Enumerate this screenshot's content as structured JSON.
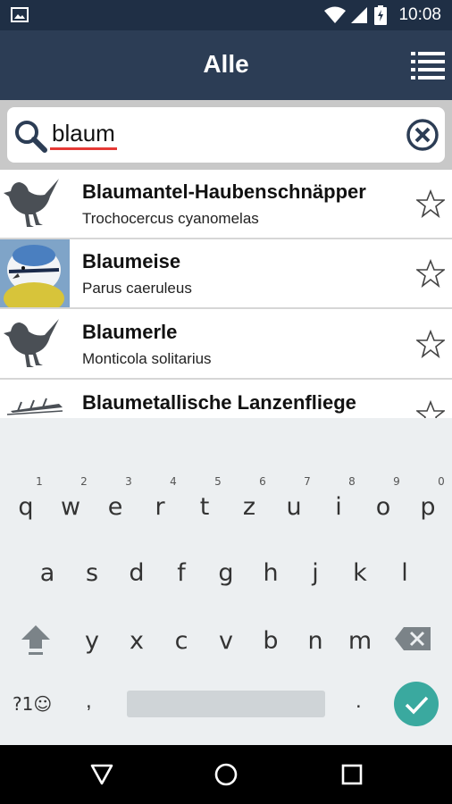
{
  "status_bar": {
    "time": "10:08",
    "icons": [
      "image-icon",
      "wifi-icon",
      "cell-signal-icon",
      "battery-icon"
    ]
  },
  "app_bar": {
    "title": "Alle",
    "menu_icon": "list-icon"
  },
  "search": {
    "query": "blaum",
    "search_icon": "search-icon",
    "clear_icon": "clear-icon"
  },
  "results": [
    {
      "name": "Blaumantel-Haubenschnäpper",
      "scientific": "Trochocercus cyanomelas",
      "thumbnail": "bird-silhouette-icon",
      "favorite_icon": "star-outline-icon"
    },
    {
      "name": "Blaumeise",
      "scientific": "Parus caeruleus",
      "thumbnail": "blue-tit-photo",
      "favorite_icon": "star-outline-icon"
    },
    {
      "name": "Blaumerle",
      "scientific": "Monticola solitarius",
      "thumbnail": "bird-silhouette-icon",
      "favorite_icon": "star-outline-icon"
    },
    {
      "name": "Blaumetallische Lanzenfliege",
      "scientific": "",
      "thumbnail": "insect-silhouette-icon",
      "favorite_icon": "star-outline-icon"
    }
  ],
  "keyboard": {
    "row1": [
      "q",
      "w",
      "e",
      "r",
      "t",
      "z",
      "u",
      "i",
      "o",
      "p"
    ],
    "row1_hints": [
      "1",
      "2",
      "3",
      "4",
      "5",
      "6",
      "7",
      "8",
      "9",
      "0"
    ],
    "row2": [
      "a",
      "s",
      "d",
      "f",
      "g",
      "h",
      "j",
      "k",
      "l"
    ],
    "row3": [
      "y",
      "x",
      "c",
      "v",
      "b",
      "n",
      "m"
    ],
    "symbols_label": "?1☺",
    "comma": ",",
    "period": "."
  },
  "nav_bar": {
    "icons": [
      "back-icon",
      "home-icon",
      "recents-icon"
    ]
  },
  "colors": {
    "app_bar": "#2c3d55",
    "status_bar": "#1f2f45",
    "accent_enter": "#3aa99f",
    "spell_underline": "#e53935"
  }
}
